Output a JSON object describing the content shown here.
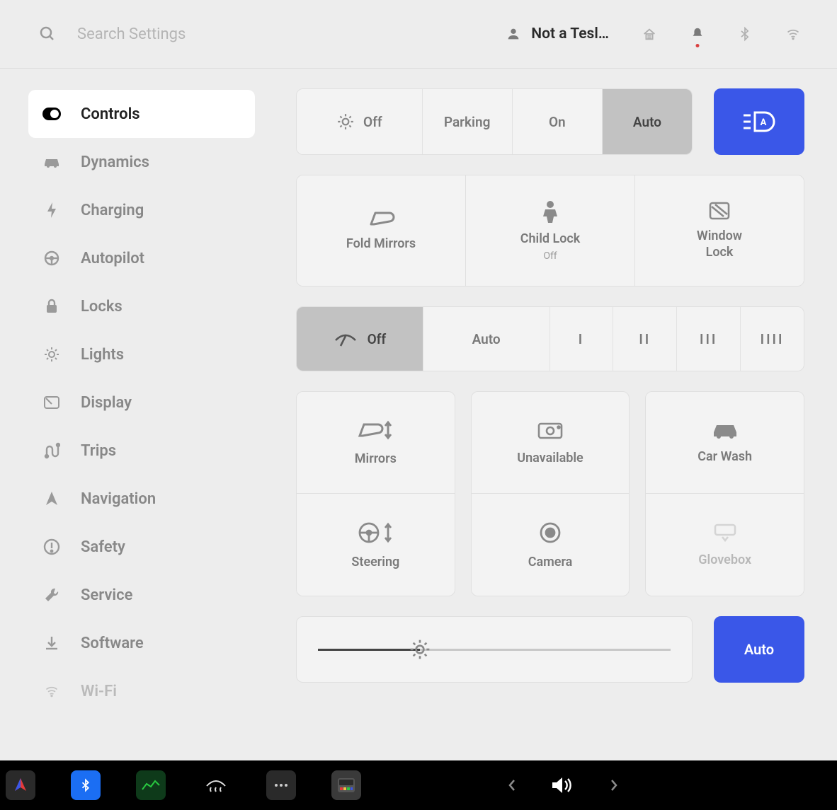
{
  "header": {
    "search_placeholder": "Search Settings",
    "profile_name": "Not a Tesl…"
  },
  "sidebar": {
    "items": [
      {
        "label": "Controls",
        "icon": "toggle"
      },
      {
        "label": "Dynamics",
        "icon": "car"
      },
      {
        "label": "Charging",
        "icon": "bolt"
      },
      {
        "label": "Autopilot",
        "icon": "steering"
      },
      {
        "label": "Locks",
        "icon": "lock"
      },
      {
        "label": "Lights",
        "icon": "sun"
      },
      {
        "label": "Display",
        "icon": "display"
      },
      {
        "label": "Trips",
        "icon": "route"
      },
      {
        "label": "Navigation",
        "icon": "nav"
      },
      {
        "label": "Safety",
        "icon": "alert"
      },
      {
        "label": "Service",
        "icon": "wrench"
      },
      {
        "label": "Software",
        "icon": "download"
      },
      {
        "label": "Wi-Fi",
        "icon": "wifi"
      }
    ],
    "active_index": 0
  },
  "lights_segment": {
    "options": [
      "Off",
      "Parking",
      "On",
      "Auto"
    ],
    "selected": "Auto"
  },
  "row2_tiles": [
    {
      "label": "Fold Mirrors",
      "sub": ""
    },
    {
      "label": "Child Lock",
      "sub": "Off"
    },
    {
      "label": "Window\nLock",
      "sub": ""
    }
  ],
  "wiper_segment": {
    "options": [
      "Off",
      "Auto",
      "I",
      "II",
      "III",
      "IIII"
    ],
    "selected": "Off"
  },
  "grid6": [
    {
      "label": "Mirrors",
      "disabled": false
    },
    {
      "label": "Unavailable",
      "disabled": false
    },
    {
      "label": "Car Wash",
      "disabled": false
    },
    {
      "label": "Steering",
      "disabled": false
    },
    {
      "label": "Camera",
      "disabled": false
    },
    {
      "label": "Glovebox",
      "disabled": true
    }
  ],
  "brightness": {
    "percent": 29,
    "auto_label": "Auto"
  },
  "colors": {
    "accent": "#3a57e8"
  }
}
